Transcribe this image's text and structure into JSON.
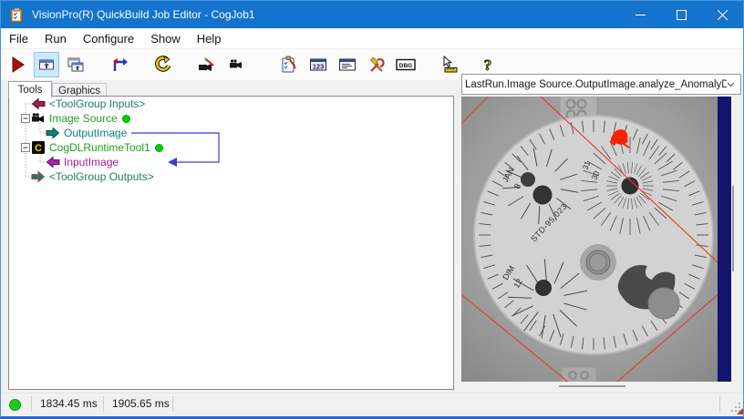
{
  "window": {
    "title": "VisionPro(R) QuickBuild Job Editor - CogJob1"
  },
  "menu": {
    "items": [
      "File",
      "Run",
      "Configure",
      "Show",
      "Help"
    ]
  },
  "toolbar": {
    "posted_label": "123",
    "debug_label": "DBG",
    "help_label": "?"
  },
  "tabs": {
    "tools": "Tools",
    "graphics": "Graphics"
  },
  "tree": {
    "c_glyph": "C",
    "rows": [
      {
        "label": "<ToolGroup Inputs>",
        "color": "#1e7a68"
      },
      {
        "label": "Image Source",
        "color": "#21a121"
      },
      {
        "label": "OutputImage",
        "color": "#0e8080"
      },
      {
        "label": "CogDLRuntimeTool1",
        "color": "#21a121"
      },
      {
        "label": "InputImage",
        "color": "#a21aa2"
      },
      {
        "label": "<ToolGroup Outputs>",
        "color": "#1e7a68"
      }
    ]
  },
  "display": {
    "selector": "LastRun.Image Source.OutputImage.analyze_AnomalyDete",
    "dial_labels": {
      "jan": "JAN",
      "eight": "8",
      "thirtyone": "31",
      "thirty": "30",
      "std": "STD-95.023",
      "dim": "DIM",
      "twelve": "12"
    }
  },
  "status": {
    "time1": "1834.45 ms",
    "time2": "1905.65 ms"
  },
  "colors": {
    "titlebar": "#1473cd",
    "anomaly_red": "#ff2000",
    "region_red": "#e23b2e",
    "navy_bar": "#14146e",
    "status_green": "#1ec81e",
    "routing_blue": "#3b3bd6"
  }
}
